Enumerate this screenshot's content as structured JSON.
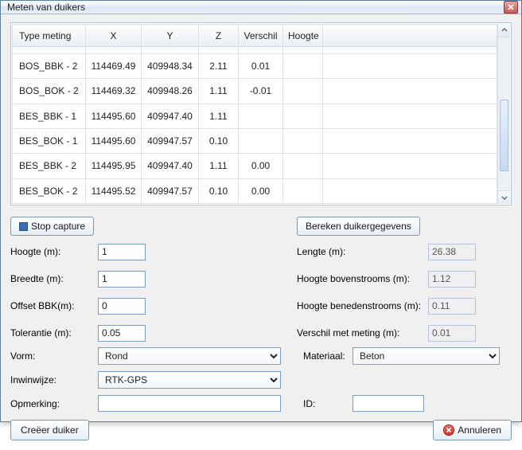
{
  "window": {
    "title": "Meten van duikers"
  },
  "grid": {
    "headers": [
      "Type meting",
      "X",
      "Y",
      "Z",
      "Verschil",
      "Hoogte"
    ],
    "rows": [
      {
        "type": "BOS_BBK - 2",
        "x": "114469.49",
        "y": "409948.34",
        "z": "2.11",
        "diff": "0.01",
        "hoogte": ""
      },
      {
        "type": "BOS_BOK - 2",
        "x": "114469.32",
        "y": "409948.26",
        "z": "1.11",
        "diff": "-0.01",
        "hoogte": ""
      },
      {
        "type": "BES_BBK - 1",
        "x": "114495.60",
        "y": "409947.40",
        "z": "1.11",
        "diff": "",
        "hoogte": ""
      },
      {
        "type": "BES_BOK - 1",
        "x": "114495.60",
        "y": "409947.57",
        "z": "0.10",
        "diff": "",
        "hoogte": ""
      },
      {
        "type": "BES_BBK - 2",
        "x": "114495.95",
        "y": "409947.40",
        "z": "1.11",
        "diff": "0.00",
        "hoogte": ""
      },
      {
        "type": "BES_BOK - 2",
        "x": "114495.52",
        "y": "409947.57",
        "z": "0.10",
        "diff": "0.00",
        "hoogte": ""
      }
    ]
  },
  "buttons": {
    "stop_capture": "Stop capture",
    "bereken": "Bereken duikergegevens",
    "create": "Creëer duiker",
    "cancel": "Annuleren"
  },
  "left": {
    "hoogte_lbl": "Hoogte (m):",
    "hoogte_val": "1",
    "breedte_lbl": "Breedte (m):",
    "breedte_val": "1",
    "offset_lbl": "Offset BBK(m):",
    "offset_val": "0",
    "tol_lbl": "Tolerantie (m):",
    "tol_val": "0.05"
  },
  "right": {
    "lengte_lbl": "Lengte (m):",
    "lengte_val": "26.38",
    "hbov_lbl": "Hoogte bovenstrooms (m):",
    "hbov_val": "1.12",
    "hben_lbl": "Hoogte benedenstrooms (m):",
    "hben_val": "0.11",
    "vmm_lbl": "Verschil met meting (m):",
    "vmm_val": "0.01"
  },
  "bottom": {
    "vorm_lbl": "Vorm:",
    "vorm_val": "Rond",
    "inwin_lbl": "Inwinwijze:",
    "inwin_val": "RTK-GPS",
    "opm_lbl": "Opmerking:",
    "opm_val": "",
    "mat_lbl": "Materiaal:",
    "mat_val": "Beton",
    "id_lbl": "ID:",
    "id_val": ""
  }
}
